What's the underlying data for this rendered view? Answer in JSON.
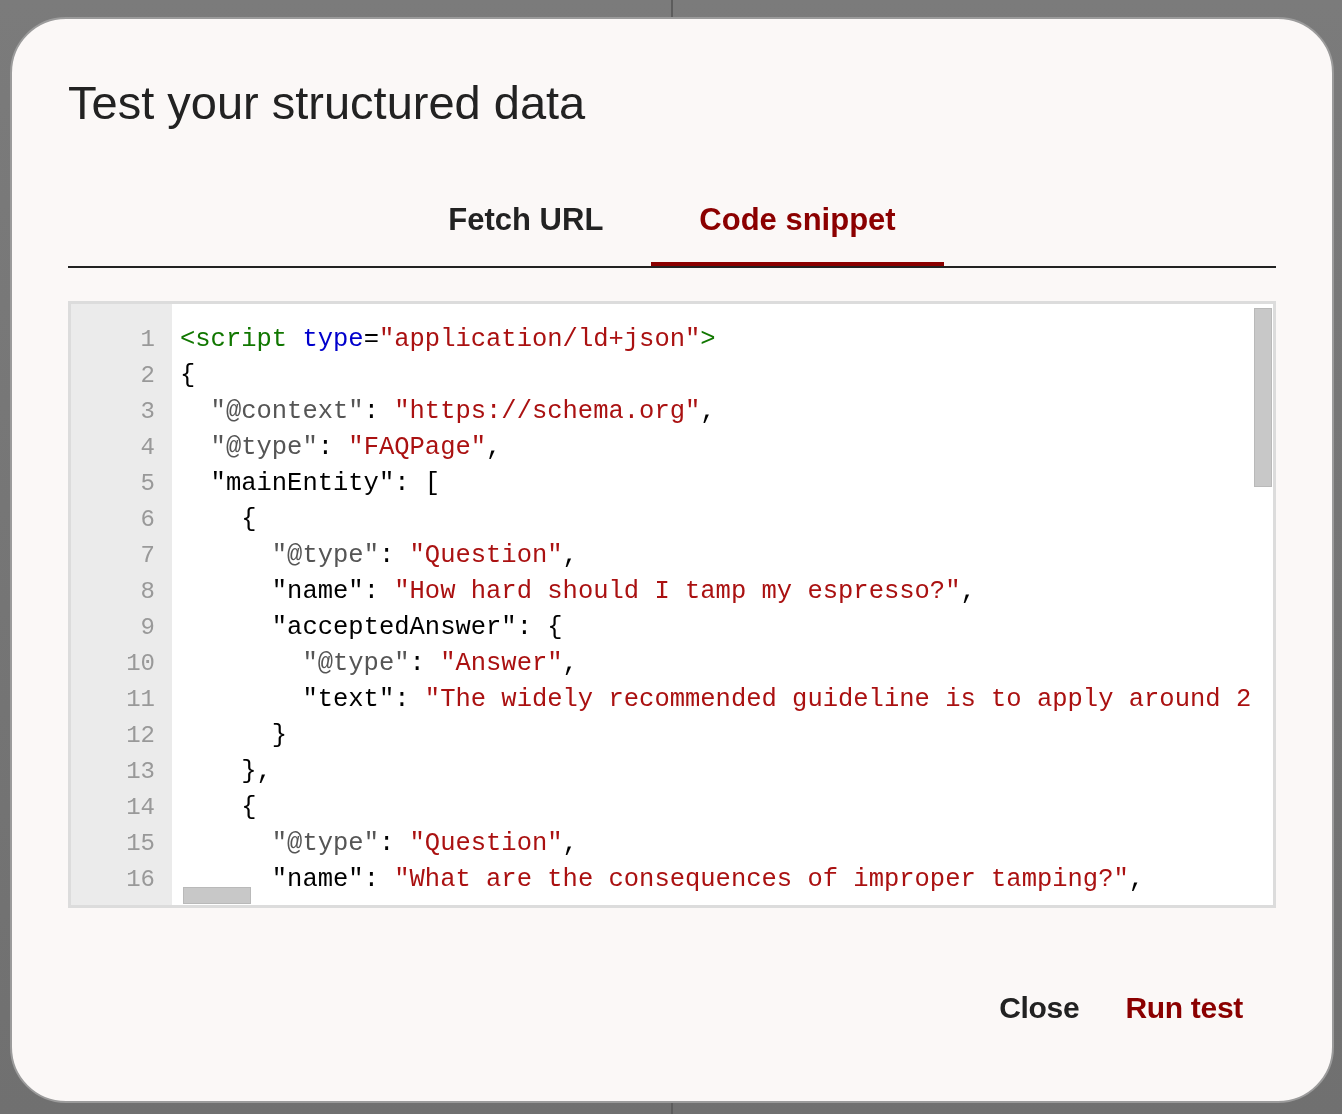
{
  "dialog": {
    "title": "Test your structured data"
  },
  "tabs": [
    {
      "label": "Fetch URL",
      "selected": false
    },
    {
      "label": "Code snippet",
      "selected": true
    }
  ],
  "editor": {
    "lines": [
      {
        "number": "1",
        "tokens": [
          {
            "text": "<script",
            "kind": "tag"
          },
          {
            "text": " type",
            "kind": "attribute"
          },
          {
            "text": "=",
            "kind": "punctuation"
          },
          {
            "text": "\"application/ld+json\"",
            "kind": "string"
          },
          {
            "text": ">",
            "kind": "tag"
          }
        ]
      },
      {
        "number": "2",
        "tokens": [
          {
            "text": "{",
            "kind": "punctuation"
          }
        ]
      },
      {
        "number": "3",
        "tokens": [
          {
            "text": "  \"@context\"",
            "kind": "keyword"
          },
          {
            "text": ": ",
            "kind": "punctuation"
          },
          {
            "text": "\"https://schema.org\"",
            "kind": "string"
          },
          {
            "text": ",",
            "kind": "punctuation"
          }
        ]
      },
      {
        "number": "4",
        "tokens": [
          {
            "text": "  \"@type\"",
            "kind": "keyword"
          },
          {
            "text": ": ",
            "kind": "punctuation"
          },
          {
            "text": "\"FAQPage\"",
            "kind": "string"
          },
          {
            "text": ",",
            "kind": "punctuation"
          }
        ]
      },
      {
        "number": "5",
        "tokens": [
          {
            "text": "  \"mainEntity\"",
            "kind": "property"
          },
          {
            "text": ": [",
            "kind": "punctuation"
          }
        ]
      },
      {
        "number": "6",
        "tokens": [
          {
            "text": "    {",
            "kind": "punctuation"
          }
        ]
      },
      {
        "number": "7",
        "tokens": [
          {
            "text": "      \"@type\"",
            "kind": "keyword"
          },
          {
            "text": ": ",
            "kind": "punctuation"
          },
          {
            "text": "\"Question\"",
            "kind": "string"
          },
          {
            "text": ",",
            "kind": "punctuation"
          }
        ]
      },
      {
        "number": "8",
        "tokens": [
          {
            "text": "      \"name\"",
            "kind": "property"
          },
          {
            "text": ": ",
            "kind": "punctuation"
          },
          {
            "text": "\"How hard should I tamp my espresso?\"",
            "kind": "string"
          },
          {
            "text": ",",
            "kind": "punctuation"
          }
        ]
      },
      {
        "number": "9",
        "tokens": [
          {
            "text": "      \"acceptedAnswer\"",
            "kind": "property"
          },
          {
            "text": ": {",
            "kind": "punctuation"
          }
        ]
      },
      {
        "number": "10",
        "tokens": [
          {
            "text": "        \"@type\"",
            "kind": "keyword"
          },
          {
            "text": ": ",
            "kind": "punctuation"
          },
          {
            "text": "\"Answer\"",
            "kind": "string"
          },
          {
            "text": ",",
            "kind": "punctuation"
          }
        ]
      },
      {
        "number": "11",
        "tokens": [
          {
            "text": "        \"text\"",
            "kind": "property"
          },
          {
            "text": ": ",
            "kind": "punctuation"
          },
          {
            "text": "\"The widely recommended guideline is to apply around 2",
            "kind": "string"
          }
        ]
      },
      {
        "number": "12",
        "tokens": [
          {
            "text": "      }",
            "kind": "punctuation"
          }
        ]
      },
      {
        "number": "13",
        "tokens": [
          {
            "text": "    },",
            "kind": "punctuation"
          }
        ]
      },
      {
        "number": "14",
        "tokens": [
          {
            "text": "    {",
            "kind": "punctuation"
          }
        ]
      },
      {
        "number": "15",
        "tokens": [
          {
            "text": "      \"@type\"",
            "kind": "keyword"
          },
          {
            "text": ": ",
            "kind": "punctuation"
          },
          {
            "text": "\"Question\"",
            "kind": "string"
          },
          {
            "text": ",",
            "kind": "punctuation"
          }
        ]
      },
      {
        "number": "16",
        "tokens": [
          {
            "text": "      \"name\"",
            "kind": "property"
          },
          {
            "text": ": ",
            "kind": "punctuation"
          },
          {
            "text": "\"What are the consequences of improper tamping?\"",
            "kind": "string"
          },
          {
            "text": ",",
            "kind": "punctuation"
          }
        ]
      }
    ]
  },
  "buttons": [
    {
      "label": "Close",
      "kind": "secondary"
    },
    {
      "label": "Run test",
      "kind": "primary"
    }
  ]
}
